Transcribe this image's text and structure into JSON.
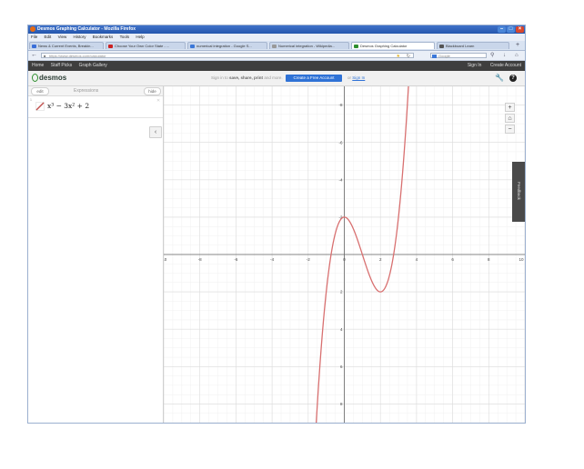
{
  "window": {
    "title": "Desmos Graphing Calculator - Mozilla Firefox"
  },
  "menu": [
    "File",
    "Edit",
    "View",
    "History",
    "Bookmarks",
    "Tools",
    "Help"
  ],
  "tabs": [
    {
      "label": "News & Current Events, Breakin...",
      "color": "#3a6fd8"
    },
    {
      "label": "Choose Your Own Color State - ...",
      "color": "#cc2222"
    },
    {
      "label": "numerical integration - Google S...",
      "color": "#3c78d8"
    },
    {
      "label": "Numerical integration - Wikipedia...",
      "color": "#999999"
    },
    {
      "label": "Desmos Graphing Calculator",
      "color": "#2f8f2f"
    },
    {
      "label": "Blackboard Learn",
      "color": "#555555"
    }
  ],
  "nav": {
    "url": "https://www.desmos.com/calculator",
    "search_placeholder": "Google"
  },
  "appbar": {
    "left": [
      "Home",
      "Staff Picks",
      "Graph Gallery"
    ],
    "right": [
      "Sign In",
      "Create Account"
    ]
  },
  "header": {
    "logo": "desmos",
    "sign_pre": "Sign in to",
    "sign_bold": "save, share, print",
    "sign_post": "and more.",
    "create_button": "Create a Free Account",
    "or": "or",
    "sign_in_link": "Sign In"
  },
  "sidebar": {
    "edit": "edit",
    "title": "Expressions",
    "hide": "hide",
    "expression": {
      "number": "1",
      "text": "x³ − 3x² + 2",
      "color": "#c0504d"
    }
  },
  "graph": {
    "x_ticks": [
      "-10",
      "-8",
      "-6",
      "-4",
      "-2",
      "0",
      "2",
      "4",
      "6",
      "8",
      "10"
    ],
    "y_ticks": [
      "8",
      "6",
      "4",
      "2",
      "-2",
      "-4",
      "-6",
      "-8"
    ],
    "curve_color": "#d87070",
    "feedback": "Feedback"
  },
  "chart_data": {
    "type": "line",
    "function": "y = x^3 - 3x^2 + 2",
    "xlim": [
      -10,
      10
    ],
    "ylim": [
      -9,
      9
    ],
    "grid": true,
    "x_tick_values": [
      -10,
      -8,
      -6,
      -4,
      -2,
      0,
      2,
      4,
      6,
      8,
      10
    ],
    "y_tick_values": [
      -8,
      -6,
      -4,
      -2,
      2,
      4,
      6,
      8
    ],
    "points": [
      [
        -1.6,
        -9.8
      ],
      [
        -1,
        -2
      ],
      [
        -0.5,
        1.125
      ],
      [
        0,
        2
      ],
      [
        1,
        0
      ],
      [
        2,
        -2
      ],
      [
        3,
        2
      ],
      [
        3.7,
        11.6
      ]
    ],
    "series": [
      {
        "name": "x³ − 3x² + 2",
        "color": "#d87070"
      }
    ]
  }
}
